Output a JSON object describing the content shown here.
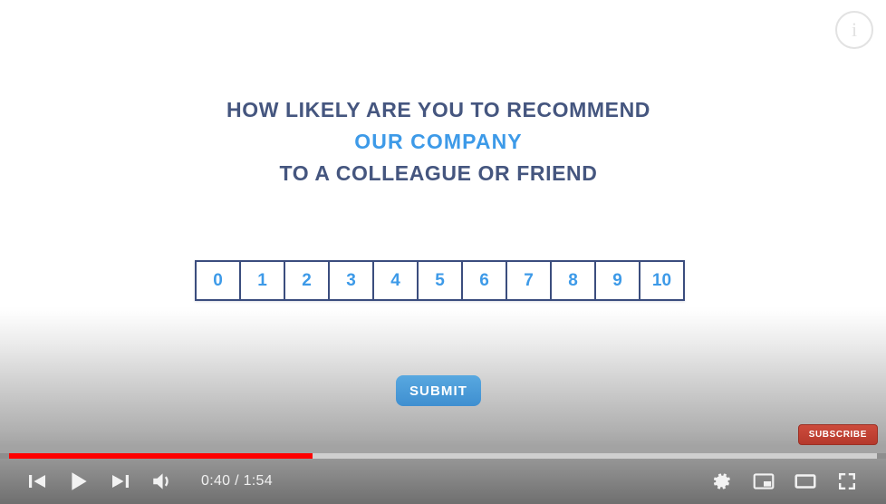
{
  "video": {
    "headline_lines": [
      {
        "text": "HOW LIKELY ARE YOU TO RECOMMEND",
        "accent": false
      },
      {
        "text": "OUR COMPANY",
        "accent": true
      },
      {
        "text": "TO A COLLEAGUE OR FRIEND",
        "accent": false
      }
    ],
    "scale": {
      "options": [
        "0",
        "1",
        "2",
        "3",
        "4",
        "5",
        "6",
        "7",
        "8",
        "9",
        "10"
      ]
    },
    "submit_label": "SUBMIT",
    "colors": {
      "headline": "#45567f",
      "accent": "#3d9ae8",
      "submit": "#3f8fd0",
      "scale_border": "#3b4d7e",
      "progress": "#ff0000",
      "subscribe": "#cd4b3c"
    }
  },
  "overlay": {
    "info_icon": "info-icon",
    "info_glyph": "i",
    "subscribe_label": "SUBSCRIBE"
  },
  "player": {
    "current_time": "0:40",
    "duration": "1:54",
    "time_display": "0:40 / 1:54",
    "progress_percent": 35,
    "buffered_percent": 100,
    "controls_left": [
      {
        "name": "previous-button",
        "icon": "previous-icon"
      },
      {
        "name": "play-button",
        "icon": "play-icon"
      },
      {
        "name": "next-button",
        "icon": "next-icon"
      },
      {
        "name": "volume-button",
        "icon": "volume-icon"
      }
    ],
    "controls_right": [
      {
        "name": "settings-button",
        "icon": "gear-icon"
      },
      {
        "name": "miniplayer-button",
        "icon": "miniplayer-icon"
      },
      {
        "name": "theater-button",
        "icon": "theater-icon"
      },
      {
        "name": "fullscreen-button",
        "icon": "fullscreen-icon"
      }
    ]
  }
}
